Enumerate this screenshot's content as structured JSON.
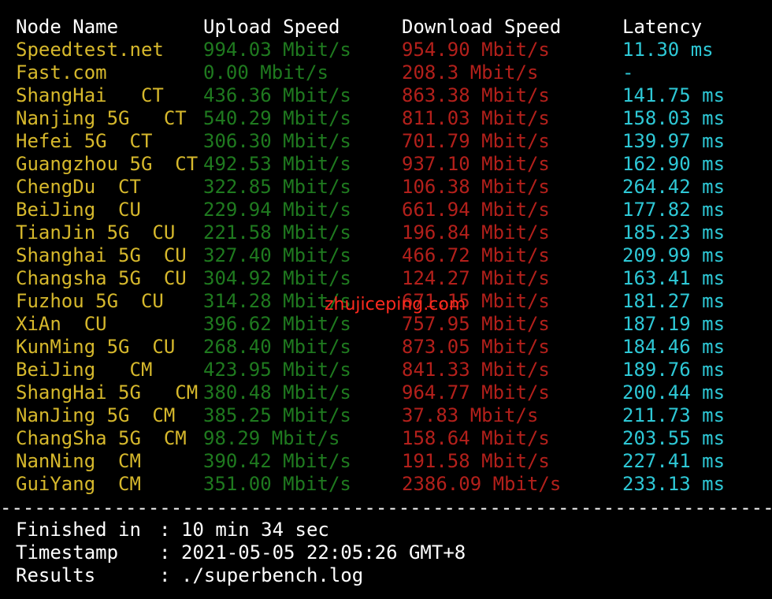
{
  "colors": {
    "background": "#000000",
    "header": "#ffffff",
    "node_name": "#d6b82c",
    "upload": "#1f7a1f",
    "download": "#b3201b",
    "latency": "#2ec8d6",
    "summary": "#ffffff",
    "watermark": "#ff2a1f"
  },
  "header": {
    "node_name": "Node Name",
    "upload_speed": "Upload Speed",
    "download_speed": "Download Speed",
    "latency": "Latency"
  },
  "rows": [
    {
      "node": "Speedtest.net",
      "upload": "994.03 Mbit/s",
      "download": "954.90 Mbit/s",
      "latency": "11.30 ms"
    },
    {
      "node": "Fast.com",
      "upload": "0.00 Mbit/s",
      "download": "208.3 Mbit/s",
      "latency": "-"
    },
    {
      "node": "ShangHai   CT",
      "upload": "436.36 Mbit/s",
      "download": "863.38 Mbit/s",
      "latency": "141.75 ms"
    },
    {
      "node": "Nanjing 5G   CT",
      "upload": "540.29 Mbit/s",
      "download": "811.03 Mbit/s",
      "latency": "158.03 ms"
    },
    {
      "node": "Hefei 5G  CT",
      "upload": "306.30 Mbit/s",
      "download": "701.79 Mbit/s",
      "latency": "139.97 ms"
    },
    {
      "node": "Guangzhou 5G  CT",
      "upload": "492.53 Mbit/s",
      "download": "937.10 Mbit/s",
      "latency": "162.90 ms"
    },
    {
      "node": "ChengDu  CT",
      "upload": "322.85 Mbit/s",
      "download": "106.38 Mbit/s",
      "latency": "264.42 ms"
    },
    {
      "node": "BeiJing  CU",
      "upload": "229.94 Mbit/s",
      "download": "661.94 Mbit/s",
      "latency": "177.82 ms"
    },
    {
      "node": "TianJin 5G  CU",
      "upload": "221.58 Mbit/s",
      "download": "196.84 Mbit/s",
      "latency": "185.23 ms"
    },
    {
      "node": "Shanghai 5G  CU",
      "upload": "327.40 Mbit/s",
      "download": "466.72 Mbit/s",
      "latency": "209.99 ms"
    },
    {
      "node": "Changsha 5G  CU",
      "upload": "304.92 Mbit/s",
      "download": "124.27 Mbit/s",
      "latency": "163.41 ms"
    },
    {
      "node": "Fuzhou 5G  CU",
      "upload": "314.28 Mbit/s",
      "download": "671.15 Mbit/s",
      "latency": "181.27 ms"
    },
    {
      "node": "XiAn  CU",
      "upload": "396.62 Mbit/s",
      "download": "757.95 Mbit/s",
      "latency": "187.19 ms"
    },
    {
      "node": "KunMing 5G  CU",
      "upload": "268.40 Mbit/s",
      "download": "873.05 Mbit/s",
      "latency": "184.46 ms"
    },
    {
      "node": "BeiJing   CM",
      "upload": "423.95 Mbit/s",
      "download": "841.33 Mbit/s",
      "latency": "189.76 ms"
    },
    {
      "node": "ShangHai 5G   CM",
      "upload": "380.48 Mbit/s",
      "download": "964.77 Mbit/s",
      "latency": "200.44 ms"
    },
    {
      "node": "NanJing 5G  CM",
      "upload": "385.25 Mbit/s",
      "download": "37.83 Mbit/s",
      "latency": "211.73 ms"
    },
    {
      "node": "ChangSha 5G  CM",
      "upload": "98.29 Mbit/s",
      "download": "158.64 Mbit/s",
      "latency": "203.55 ms"
    },
    {
      "node": "NanNing  CM",
      "upload": "390.42 Mbit/s",
      "download": "191.58 Mbit/s",
      "latency": "227.41 ms"
    },
    {
      "node": "GuiYang  CM",
      "upload": "351.00 Mbit/s",
      "download": "2386.09 Mbit/s",
      "latency": "233.13 ms"
    }
  ],
  "divider": "----------------------------------------------------------------------",
  "summary": [
    {
      "label": "Finished in",
      "separator": ":",
      "value": "10 min 34 sec"
    },
    {
      "label": "Timestamp",
      "separator": ":",
      "value": "2021-05-05 22:05:26 GMT+8"
    },
    {
      "label": "Results",
      "separator": ":",
      "value": "./superbench.log"
    }
  ],
  "watermark": "zhujiceping.com"
}
